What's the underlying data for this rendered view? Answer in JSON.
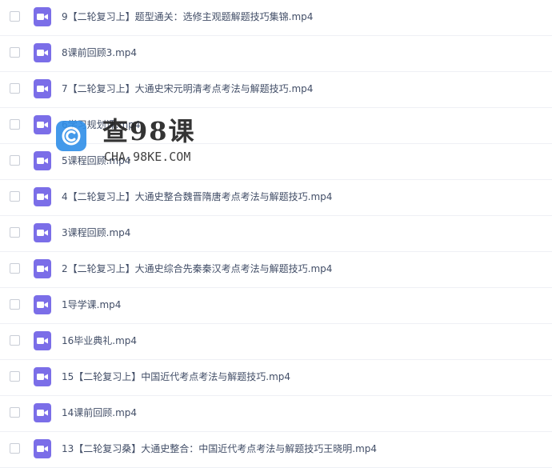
{
  "files": [
    {
      "name": "9【二轮复习上】题型通关：选修主观题解题技巧集锦.mp4",
      "icon": "video-icon"
    },
    {
      "name": "8课前回顾3.mp4",
      "icon": "video-icon"
    },
    {
      "name": "7【二轮复习上】大通史宋元明清考点考法与解题技巧.mp4",
      "icon": "video-icon"
    },
    {
      "name": "6学习规划课.mp4",
      "icon": "video-icon"
    },
    {
      "name": "5课程回顾.mp4",
      "icon": "video-icon"
    },
    {
      "name": "4【二轮复习上】大通史整合魏晋隋唐考点考法与解题技巧.mp4",
      "icon": "video-icon"
    },
    {
      "name": "3课程回顾.mp4",
      "icon": "video-icon"
    },
    {
      "name": "2【二轮复习上】大通史综合先秦秦汉考点考法与解题技巧.mp4",
      "icon": "video-icon"
    },
    {
      "name": "1导学课.mp4",
      "icon": "video-icon"
    },
    {
      "name": "16毕业典礼.mp4",
      "icon": "video-icon"
    },
    {
      "name": "15【二轮复习上】中国近代考点考法与解题技巧.mp4",
      "icon": "video-icon"
    },
    {
      "name": "14课前回顾.mp4",
      "icon": "video-icon"
    },
    {
      "name": "13【二轮复习桑】大通史整合：中国近代考点考法与解题技巧王晓明.mp4",
      "icon": "video-icon"
    }
  ],
  "watermark": {
    "title": "查98课",
    "url": "CHA.98KE.COM"
  },
  "colors": {
    "video_icon": "#7b6ee8",
    "text": "#424e67",
    "divider": "#eef0f5",
    "watermark_logo": "#2f8fe8"
  }
}
